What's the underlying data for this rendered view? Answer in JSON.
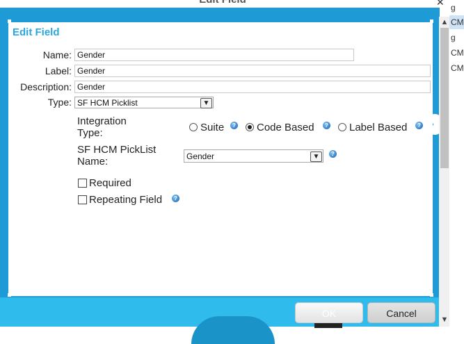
{
  "window": {
    "title": "Edit Field"
  },
  "side_panel": {
    "items": [
      "g",
      "CM",
      "g",
      "CM",
      "CM"
    ]
  },
  "form": {
    "heading": "Edit Field",
    "name": {
      "label": "Name:",
      "value": "Gender"
    },
    "label_field": {
      "label": "Label:",
      "value": "Gender"
    },
    "description": {
      "label": "Description:",
      "value": "Gender"
    },
    "type": {
      "label": "Type:",
      "selected": "SF HCM Picklist"
    },
    "integration_type": {
      "label_line1": "Integration",
      "label_line2": "Type:",
      "options": [
        "Suite",
        "Code Based",
        "Label Based"
      ],
      "selected": "Code Based"
    },
    "picklist_name": {
      "label_line1": "SF HCM PickList",
      "label_line2": "Name:",
      "selected": "Gender"
    },
    "required": {
      "label": "Required",
      "checked": false
    },
    "repeating": {
      "label": "Repeating Field",
      "checked": false
    }
  },
  "buttons": {
    "ok": "OK",
    "cancel": "Cancel"
  },
  "icons": {
    "help": "help-icon",
    "close": "close-icon",
    "dropdown": "chevron-down-icon"
  },
  "colors": {
    "accent": "#29a8e0",
    "backdrop": "#1e9bd7"
  }
}
